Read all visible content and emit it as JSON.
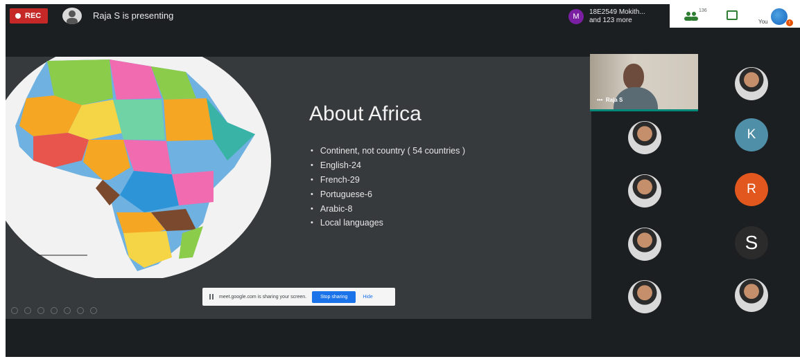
{
  "topbar": {
    "rec_label": "REC",
    "presenting_text": "Raja S is presenting",
    "participants_avatar_letter": "M",
    "participants_line1": "18E2549 Mokith...",
    "participants_line2": "and 123 more",
    "people_count": "136",
    "you_label": "You",
    "accent_color": "#c62828"
  },
  "slide": {
    "title": "About Africa",
    "bullets": [
      "Continent, not country ( 54 countries )",
      "English-24",
      "French-29",
      "Portuguese-6",
      "Arabic-8",
      "Local languages"
    ],
    "share_text": "meet.google.com is sharing your screen.",
    "stop_sharing": "Stop sharing",
    "hide": "Hide"
  },
  "self_tile": {
    "name": "Raja S",
    "border_color": "#00897b"
  },
  "participants": [
    {
      "type": "photo"
    },
    {
      "type": "photo"
    },
    {
      "type": "letter",
      "letter": "K",
      "color": "#4f8fa8"
    },
    {
      "type": "photo"
    },
    {
      "type": "letter",
      "letter": "R",
      "color": "#e2571e"
    },
    {
      "type": "photo"
    },
    {
      "type": "letter",
      "letter": "S",
      "color": "#2b2b2b"
    },
    {
      "type": "photo"
    },
    {
      "type": "photo"
    }
  ]
}
